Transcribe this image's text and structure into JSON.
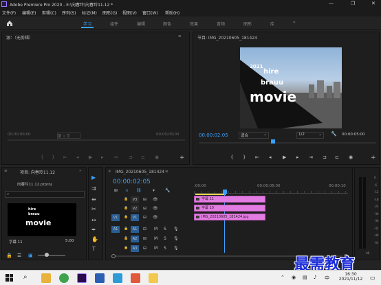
{
  "window": {
    "title": "Adobe Premiere Pro 2020 - E:\\向春玲\\向春玲11.12 *",
    "minimize": "—",
    "maximize": "❐",
    "close": "✕"
  },
  "menu": [
    "文件(F)",
    "编辑(E)",
    "剪辑(C)",
    "序列(S)",
    "标记(M)",
    "图形(G)",
    "视图(V)",
    "窗口(W)",
    "帮助(H)"
  ],
  "workspaces": {
    "home_icon": "home-icon",
    "items": [
      "学习",
      "组件",
      "编辑",
      "颜色",
      "效果",
      "音频",
      "图形",
      "库"
    ],
    "active": "学习",
    "more": "»"
  },
  "source_monitor": {
    "title": "源：（无剪辑）",
    "timecode_left": "00;00;00;00",
    "page": "第 1 页",
    "timecode_right": "00;00;00;00"
  },
  "program_monitor": {
    "title": "节目: IMG_20210605_181424",
    "timecode": "00:00:02:05",
    "fit": "适合",
    "quality": "1/2",
    "duration": "00:00:05:00",
    "overlay_year": "2021",
    "overlay_hire": "hire",
    "overlay_brauu": "brauu",
    "overlay_movie": "movie"
  },
  "project": {
    "title": "项目: 向春玲11.12",
    "file": "向春玲11.12.prproj",
    "clip_label": "字幕 11",
    "clip_duration": "5:00"
  },
  "timeline": {
    "title": "IMG_20210605_181424",
    "timecode": "00:00:02:05",
    "ruler": [
      ":00:00",
      "00:00:05:00",
      "00:00:10"
    ],
    "video_tracks": [
      "V3",
      "V2",
      "V1"
    ],
    "audio_tracks": [
      "A1",
      "A2",
      "A3"
    ],
    "source_patch_v": "V1",
    "source_patch_a": "A1",
    "clips": [
      {
        "name": "字幕 11"
      },
      {
        "name": "字幕 10"
      },
      {
        "name": "IMG_20210605_181424.jpg"
      }
    ],
    "m_label": "M",
    "s_label": "S"
  },
  "meter": {
    "scale": [
      "0",
      "-6",
      "-12",
      "-18",
      "-24",
      "-30",
      "-36",
      "-42",
      "-48",
      "-54"
    ],
    "db": "dB"
  },
  "watermark": "最需教育",
  "taskbar": {
    "time": "16:30",
    "date": "2021/11/12",
    "lang": "中"
  },
  "colors": {
    "accent": "#3aa0ff",
    "clip_pink": "#e37ce2",
    "panel_bg": "#1e1e1e"
  }
}
